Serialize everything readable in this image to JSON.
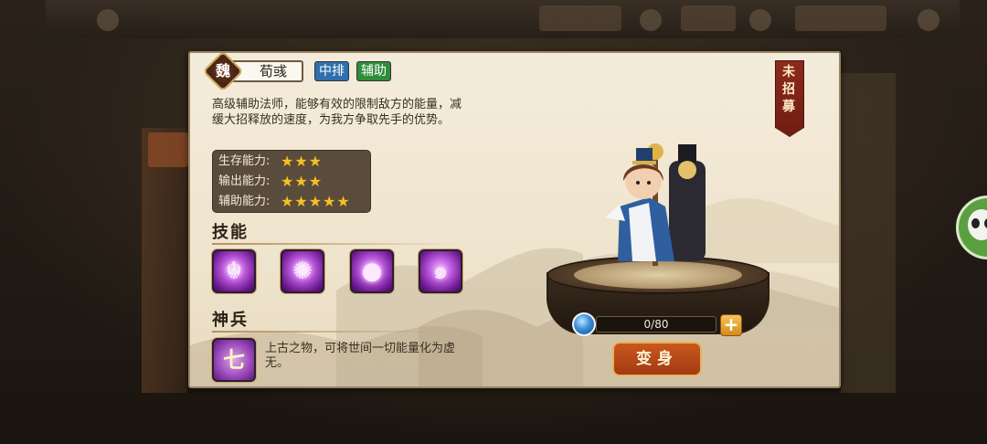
{
  "hero": {
    "faction": "魏",
    "name": "荀彧",
    "position_badge": "中排",
    "role_badge": "辅助",
    "description": "高级辅助法师，能够有效的限制敌方的能量，减缓大招释放的速度，为我方争取先手的优势。",
    "recruit_status": "未\n招\n募"
  },
  "stats": [
    {
      "label": "生存能力:",
      "stars": 3
    },
    {
      "label": "输出能力:",
      "stars": 3
    },
    {
      "label": "辅助能力:",
      "stars": 5
    }
  ],
  "skills": {
    "title": "技能",
    "icons": [
      "lion-skill-icon",
      "vortex-skill-icon",
      "orb-skill-icon",
      "dragon-skill-icon"
    ]
  },
  "weapon": {
    "title": "神兵",
    "icon": "blade-weapon-icon",
    "description": "上古之物，可将世间一切能量化为虚无。"
  },
  "progress": {
    "current": 0,
    "max": 80,
    "text": "0/80"
  },
  "transform_button": "变身",
  "colors": {
    "panel_bg": "#f2e9d6",
    "banner_red": "#8d2a1c",
    "position_blue": "#2f6fae",
    "role_green": "#2f8d3a",
    "star_gold": "#f2c02a",
    "button_orange": "#c9581e"
  }
}
